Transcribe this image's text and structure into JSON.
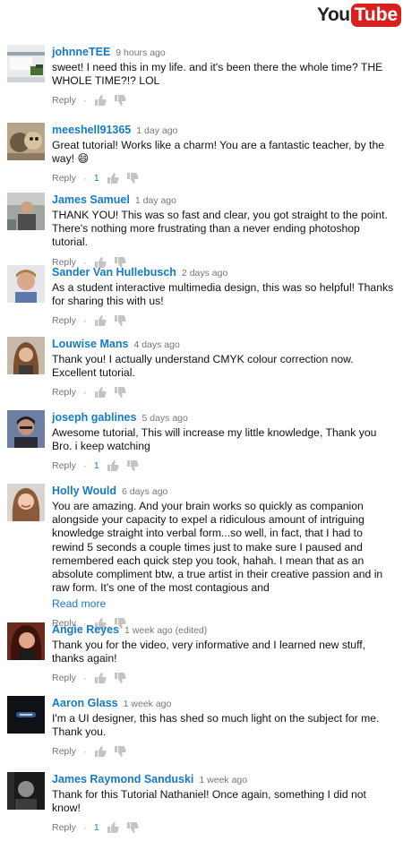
{
  "logo": {
    "you": "You",
    "tube": "Tube"
  },
  "reply_label": "Reply",
  "dot": "·",
  "read_more": "Read more",
  "comments": [
    {
      "author": "johnneTEE",
      "time": "9 hours ago",
      "text": "sweet! I need this in my life. and it's been there the whole time? THE WHOLE TIME?!? LOL",
      "likes": ""
    },
    {
      "author": "meeshell91365",
      "time": "1 day ago",
      "text": "Great tutorial! Works like a charm! You are a fantastic teacher, by the way! 😄",
      "likes": "1"
    },
    {
      "author": "James Samuel",
      "time": "1 day ago",
      "text": "THANK YOU! This was so fast and clear, you got straight to the point. There's nothing more frustrating than a never ending photoshop tutorial.",
      "likes": ""
    },
    {
      "author": "Sander Van Hullebusch",
      "time": "2 days ago",
      "text": "As a student interactive multimedia design, this was so helpful! Thanks for sharing this with us!",
      "likes": ""
    },
    {
      "author": "Louwise Mans",
      "time": "4 days ago",
      "text": "Thank you!  I actually understand CMYK colour correction now.  Excellent tutorial.",
      "likes": ""
    },
    {
      "author": "joseph gablines",
      "time": "5 days ago",
      "text": "Awesome tutorial, This will increase my little knowledge, Thank you Bro. i keep watching",
      "likes": "1"
    },
    {
      "author": "Holly Would",
      "time": "6 days ago",
      "text": "You are amazing.  And your brain works so quickly as companion alongside your capacity to expel a ridiculous amount of intriguing knowledge straight into verbal form...so well, in fact,  that I had to rewind 5 seconds a couple times just to make sure I paused and remembered each quick step you took, hahah.  I mean that as an absolute compliment btw, a true artist in their creative passion and in raw form.  It's one of the most contagious and",
      "likes": ""
    },
    {
      "author": "Angie Reyes",
      "time": "1 week ago (edited)",
      "text": "Thank you for the video, very informative and I learned new stuff, thanks again!",
      "likes": ""
    },
    {
      "author": "Aaron Glass",
      "time": "1 week ago",
      "text": "I'm a UI designer, this has shed so much light on the subject for me. Thank you.",
      "likes": ""
    },
    {
      "author": "James Raymond Sanduski",
      "time": "1 week ago",
      "text": "Thank for this Tutorial Nathaniel!  Once again, something I did not know!",
      "likes": "1"
    }
  ]
}
